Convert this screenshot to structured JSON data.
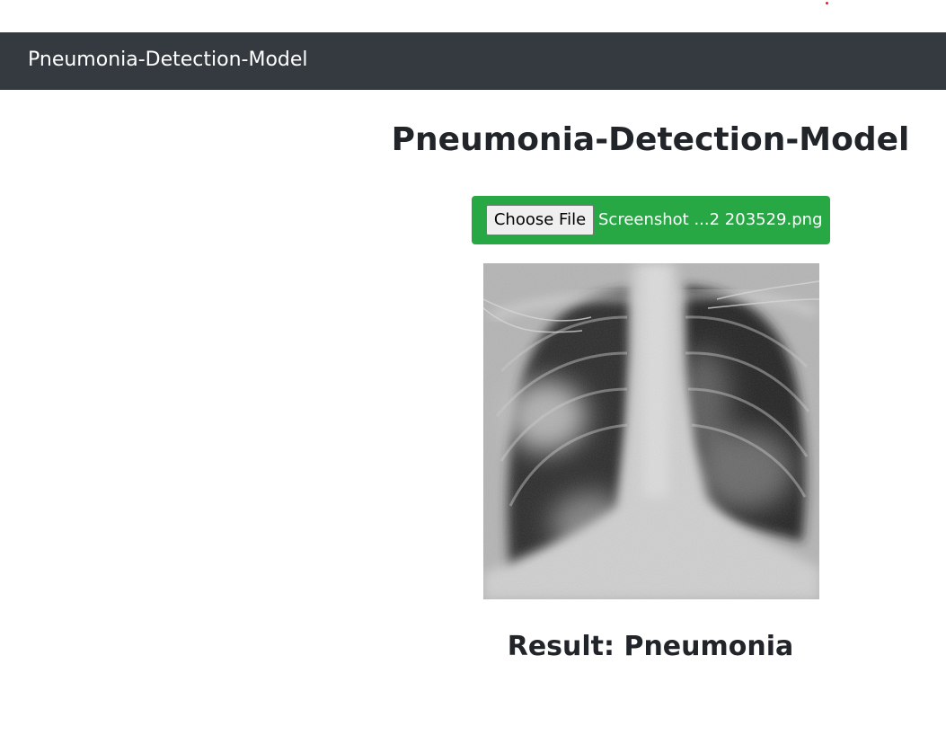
{
  "navbar": {
    "brand": "Pneumonia-Detection-Model"
  },
  "main": {
    "title": "Pneumonia-Detection-Model",
    "upload": {
      "button_label": "Choose File",
      "file_name": "Screenshot ...2 203529.png"
    },
    "image": {
      "description_icon": "chest-xray-image"
    },
    "result_text": "Result: Pneumonia"
  },
  "colors": {
    "navbar_bg": "#343a40",
    "upload_bg": "#28a745",
    "text": "#212529"
  }
}
